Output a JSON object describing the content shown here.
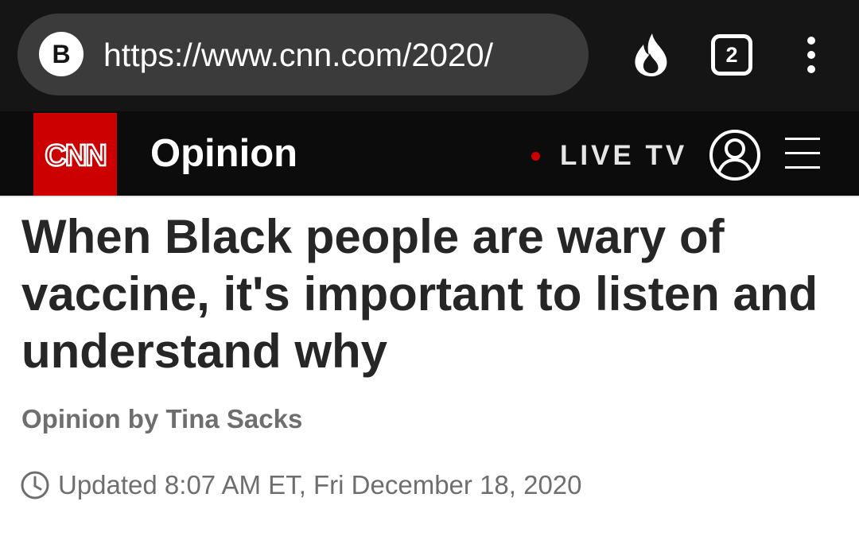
{
  "browser": {
    "badge_letter": "B",
    "url": "https://www.cnn.com/2020/",
    "tab_count": "2",
    "icons": [
      "fire-icon",
      "tabs-icon",
      "more-vertical-icon"
    ]
  },
  "header": {
    "logo_text": "CNN",
    "section": "Opinion",
    "live_label": "LIVE TV",
    "icons": [
      "account-icon",
      "menu-icon"
    ]
  },
  "article": {
    "headline": "When Black people are wary of vaccine, it's important to listen and understand why",
    "byline": "Opinion by Tina Sacks",
    "updated": "Updated 8:07 AM ET, Fri December 18, 2020"
  },
  "colors": {
    "brand_red": "#cc0000",
    "header_bg": "#0c0c0c",
    "browser_bg": "#151515",
    "url_pill": "#3b3b3b",
    "headline_text": "#262626",
    "meta_text": "#6e6e6e"
  }
}
